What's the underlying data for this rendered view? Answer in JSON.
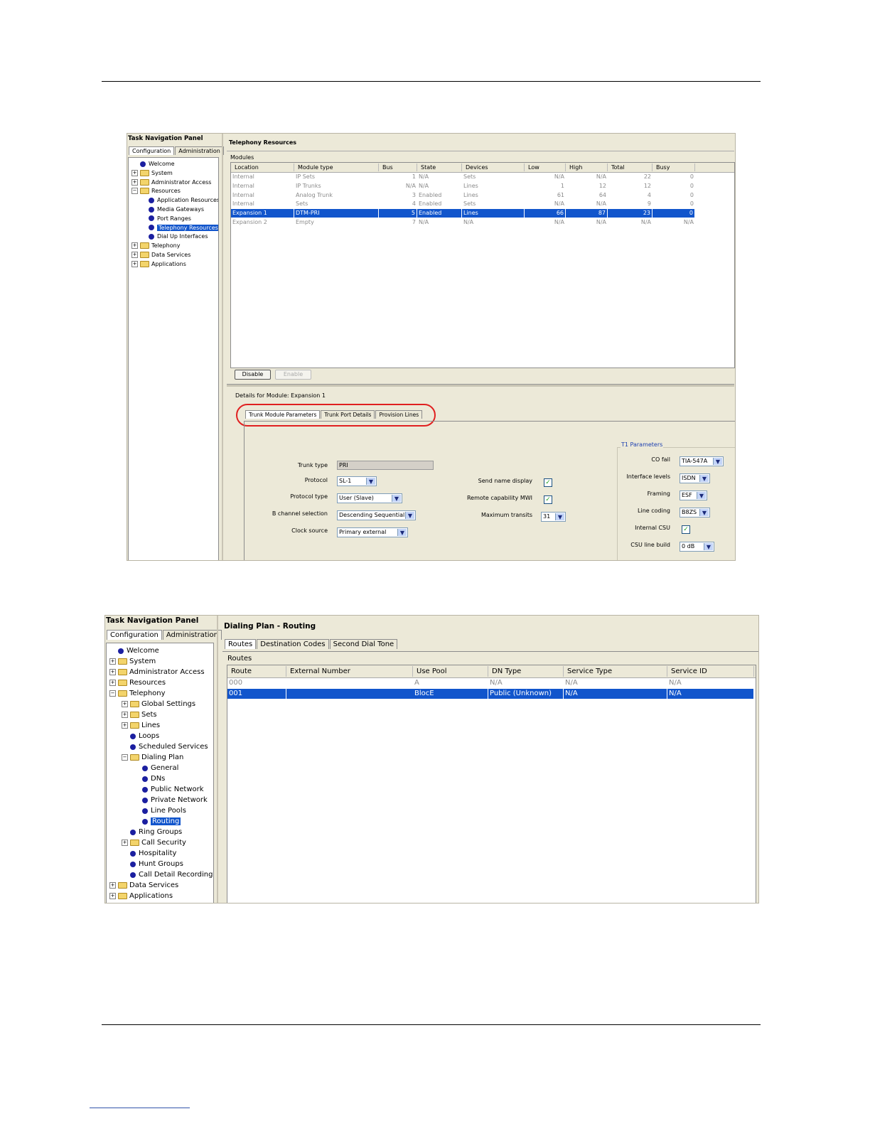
{
  "shot1": {
    "nav_title": "Task Navigation Panel",
    "tabs": [
      "Configuration",
      "Administration"
    ],
    "tree": [
      {
        "label": "Welcome",
        "type": "leaf",
        "indent": 0
      },
      {
        "label": "System",
        "type": "folder",
        "indent": 0
      },
      {
        "label": "Administrator Access",
        "type": "folder",
        "indent": 0
      },
      {
        "label": "Resources",
        "type": "folder-open",
        "indent": 0
      },
      {
        "label": "Application Resources",
        "type": "leaf",
        "indent": 1
      },
      {
        "label": "Media Gateways",
        "type": "leaf",
        "indent": 1
      },
      {
        "label": "Port Ranges",
        "type": "leaf",
        "indent": 1
      },
      {
        "label": "Telephony Resources",
        "type": "leaf",
        "indent": 1,
        "selected": true
      },
      {
        "label": "Dial Up Interfaces",
        "type": "leaf",
        "indent": 1
      },
      {
        "label": "Telephony",
        "type": "folder",
        "indent": 0
      },
      {
        "label": "Data Services",
        "type": "folder",
        "indent": 0
      },
      {
        "label": "Applications",
        "type": "folder",
        "indent": 0
      }
    ],
    "panel_title": "Telephony Resources",
    "modules_label": "Modules",
    "columns": [
      "Location",
      "Module type",
      "Bus",
      "State",
      "Devices",
      "Low",
      "High",
      "Total",
      "Busy"
    ],
    "rows": [
      {
        "cells": [
          "Internal",
          "IP Sets",
          "1",
          "N/A",
          "Sets",
          "N/A",
          "N/A",
          "22",
          "0"
        ],
        "style": "muted"
      },
      {
        "cells": [
          "Internal",
          "IP Trunks",
          "N/A",
          "N/A",
          "Lines",
          "1",
          "12",
          "12",
          "0"
        ],
        "style": "muted"
      },
      {
        "cells": [
          "Internal",
          "Analog Trunk",
          "3",
          "Enabled",
          "Lines",
          "61",
          "64",
          "4",
          "0"
        ],
        "style": "muted"
      },
      {
        "cells": [
          "Internal",
          "Sets",
          "4",
          "Enabled",
          "Sets",
          "N/A",
          "N/A",
          "9",
          "0"
        ],
        "style": "muted"
      },
      {
        "cells": [
          "Expansion 1",
          "DTM-PRI",
          "5",
          "Enabled",
          "Lines",
          "66",
          "87",
          "23",
          "0"
        ],
        "style": "selected"
      },
      {
        "cells": [
          "Expansion 2",
          "Empty",
          "7",
          "N/A",
          "N/A",
          "N/A",
          "N/A",
          "N/A",
          "N/A"
        ],
        "style": "muted"
      }
    ],
    "disable_button": "Disable",
    "enable_button": "Enable",
    "details_label": "Details for Module: Expansion 1",
    "detail_tabs": [
      "Trunk Module Parameters",
      "Trunk Port Details",
      "Provision Lines"
    ],
    "fields": {
      "trunk_type_label": "Trunk type",
      "trunk_type_value": "PRI",
      "protocol_label": "Protocol",
      "protocol_value": "SL-1",
      "protocol_type_label": "Protocol type",
      "protocol_type_value": "User (Slave)",
      "b_channel_label": "B channel selection",
      "b_channel_value": "Descending Sequential",
      "clock_source_label": "Clock source",
      "clock_source_value": "Primary external",
      "send_name_label": "Send name display",
      "remote_mwi_label": "Remote capability MWI",
      "max_transits_label": "Maximum transits",
      "max_transits_value": "31"
    },
    "t1": {
      "legend": "T1 Parameters",
      "co_fail_label": "CO fail",
      "co_fail_value": "TIA-547A",
      "interface_label": "Interface levels",
      "interface_value": "ISDN",
      "framing_label": "Framing",
      "framing_value": "ESF",
      "line_coding_label": "Line coding",
      "line_coding_value": "B8ZS",
      "internal_csu_label": "Internal CSU",
      "csu_build_label": "CSU line build",
      "csu_build_value": "0 dB"
    },
    "highlight_color": "#1155cc",
    "annotation_color": "#e02020"
  },
  "shot2": {
    "nav_title": "Task Navigation Panel",
    "tabs": [
      "Configuration",
      "Administration"
    ],
    "tree": [
      {
        "label": "Welcome",
        "type": "leaf",
        "indent": 0
      },
      {
        "label": "System",
        "type": "folder",
        "indent": 0
      },
      {
        "label": "Administrator Access",
        "type": "folder",
        "indent": 0
      },
      {
        "label": "Resources",
        "type": "folder",
        "indent": 0
      },
      {
        "label": "Telephony",
        "type": "folder-open",
        "indent": 0
      },
      {
        "label": "Global Settings",
        "type": "folder",
        "indent": 1
      },
      {
        "label": "Sets",
        "type": "folder",
        "indent": 1
      },
      {
        "label": "Lines",
        "type": "folder",
        "indent": 1
      },
      {
        "label": "Loops",
        "type": "leaf",
        "indent": 1
      },
      {
        "label": "Scheduled Services",
        "type": "leaf",
        "indent": 1
      },
      {
        "label": "Dialing Plan",
        "type": "folder-open",
        "indent": 1
      },
      {
        "label": "General",
        "type": "leaf",
        "indent": 2
      },
      {
        "label": "DNs",
        "type": "leaf",
        "indent": 2
      },
      {
        "label": "Public Network",
        "type": "leaf",
        "indent": 2
      },
      {
        "label": "Private Network",
        "type": "leaf",
        "indent": 2
      },
      {
        "label": "Line Pools",
        "type": "leaf",
        "indent": 2
      },
      {
        "label": "Routing",
        "type": "leaf",
        "indent": 2,
        "selected": true
      },
      {
        "label": "Ring Groups",
        "type": "leaf",
        "indent": 1
      },
      {
        "label": "Call Security",
        "type": "folder",
        "indent": 1
      },
      {
        "label": "Hospitality",
        "type": "leaf",
        "indent": 1
      },
      {
        "label": "Hunt Groups",
        "type": "leaf",
        "indent": 1
      },
      {
        "label": "Call Detail Recording",
        "type": "leaf",
        "indent": 1
      },
      {
        "label": "Data Services",
        "type": "folder",
        "indent": 0
      },
      {
        "label": "Applications",
        "type": "folder",
        "indent": 0
      }
    ],
    "panel_title": "Dialing Plan - Routing",
    "tabs_main": [
      "Routes",
      "Destination Codes",
      "Second Dial Tone"
    ],
    "routes_label": "Routes",
    "columns": [
      "Route",
      "External Number",
      "Use Pool",
      "DN Type",
      "Service Type",
      "Service ID"
    ],
    "rows": [
      {
        "cells": [
          "000",
          "",
          "A",
          "N/A",
          "N/A",
          "N/A"
        ],
        "style": "muted"
      },
      {
        "cells": [
          "001",
          "",
          "BlocE",
          "Public (Unknown)",
          "N/A",
          "N/A"
        ],
        "style": "selected"
      }
    ]
  }
}
